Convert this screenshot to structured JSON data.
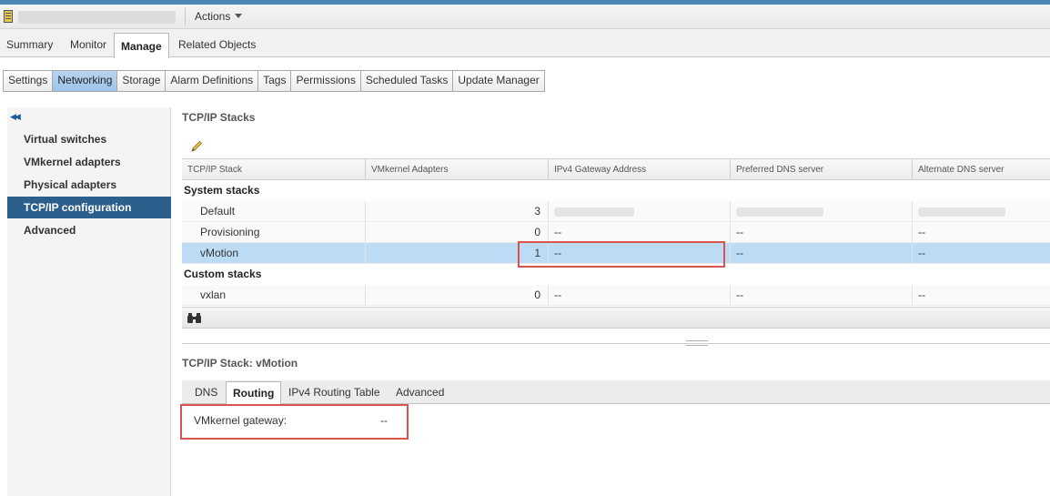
{
  "header": {
    "actions_label": "Actions"
  },
  "main_tabs": [
    "Summary",
    "Monitor",
    "Manage",
    "Related Objects"
  ],
  "sub_tabs": [
    "Settings",
    "Networking",
    "Storage",
    "Alarm Definitions",
    "Tags",
    "Permissions",
    "Scheduled Tasks",
    "Update Manager"
  ],
  "left_nav": {
    "items": [
      "Virtual switches",
      "VMkernel adapters",
      "Physical adapters",
      "TCP/IP configuration",
      "Advanced"
    ],
    "active": "TCP/IP configuration"
  },
  "stacks": {
    "title": "TCP/IP Stacks",
    "columns": [
      "TCP/IP Stack",
      "VMkernel Adapters",
      "IPv4 Gateway Address",
      "Preferred DNS server",
      "Alternate DNS server"
    ],
    "groups": [
      {
        "name": "System stacks",
        "rows": [
          {
            "name": "Default",
            "adapters": "3",
            "gateway": "",
            "preferred_dns": "",
            "alternate_dns": ""
          },
          {
            "name": "Provisioning",
            "adapters": "0",
            "gateway": "--",
            "preferred_dns": "--",
            "alternate_dns": "--"
          },
          {
            "name": "vMotion",
            "adapters": "1",
            "gateway": "--",
            "preferred_dns": "--",
            "alternate_dns": "--"
          }
        ]
      },
      {
        "name": "Custom stacks",
        "rows": [
          {
            "name": "vxlan",
            "adapters": "0",
            "gateway": "--",
            "preferred_dns": "--",
            "alternate_dns": "--"
          }
        ]
      }
    ],
    "selected_row": "vMotion"
  },
  "detail": {
    "title": "TCP/IP Stack: vMotion",
    "tabs": [
      "DNS",
      "Routing",
      "IPv4 Routing Table",
      "Advanced"
    ],
    "active_tab": "Routing",
    "fields": {
      "gateway_label": "VMkernel gateway:",
      "gateway_value": "--"
    }
  },
  "colors": {
    "accent": "#4b87b5",
    "selected_nav": "#2d5f8c",
    "selected_row": "#bcdcf5",
    "highlight_box": "#d9534f"
  },
  "icons": [
    "host-icon",
    "collapse-icon",
    "pencil-edit-icon",
    "binoculars-filter-icon",
    "dropdown-caret-icon"
  ]
}
